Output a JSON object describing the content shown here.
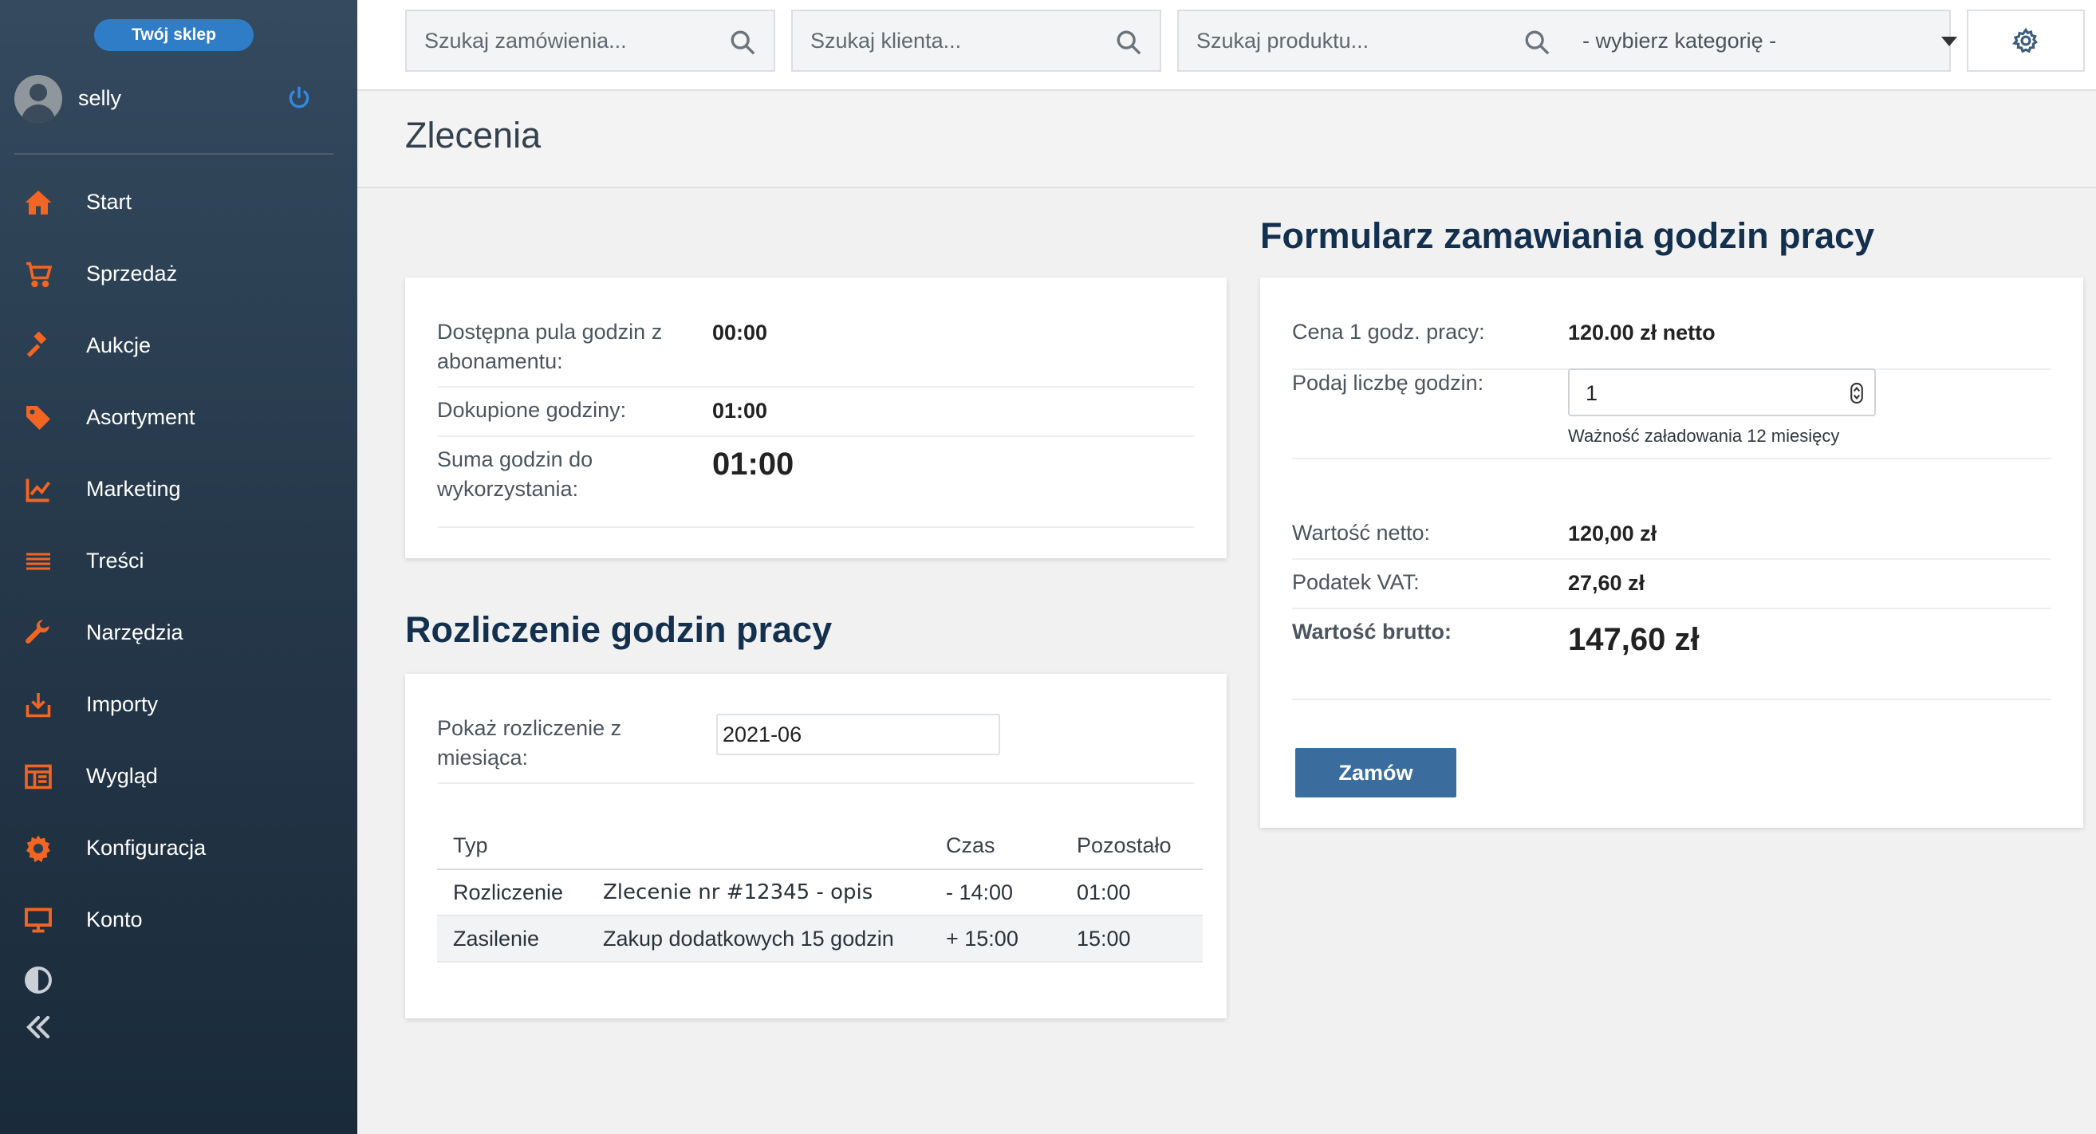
{
  "sidebar": {
    "shop_button": "Twój sklep",
    "user_name": "selly",
    "items": [
      {
        "label": "Start",
        "icon": "home-icon"
      },
      {
        "label": "Sprzedaż",
        "icon": "cart-icon"
      },
      {
        "label": "Aukcje",
        "icon": "gavel-icon"
      },
      {
        "label": "Asortyment",
        "icon": "tag-icon"
      },
      {
        "label": "Marketing",
        "icon": "chart-line-icon"
      },
      {
        "label": "Treści",
        "icon": "lines-icon"
      },
      {
        "label": "Narzędzia",
        "icon": "wrench-icon"
      },
      {
        "label": "Importy",
        "icon": "import-icon"
      },
      {
        "label": "Wygląd",
        "icon": "layout-icon"
      },
      {
        "label": "Konfiguracja",
        "icon": "gear-icon"
      },
      {
        "label": "Konto",
        "icon": "monitor-icon"
      }
    ]
  },
  "topbar": {
    "search_orders_placeholder": "Szukaj zamówienia...",
    "search_clients_placeholder": "Szukaj klienta...",
    "search_products_placeholder": "Szukaj produktu...",
    "category_select": "- wybierz kategorię -"
  },
  "page": {
    "title": "Zlecenia"
  },
  "hours_summary": {
    "available_label": "Dostępna pula godzin z abonamentu:",
    "available_value": "00:00",
    "purchased_label": "Dokupione godziny:",
    "purchased_value": "01:00",
    "total_label": "Suma godzin do wykorzystania:",
    "total_value": "01:00"
  },
  "settlement": {
    "title": "Rozliczenie godzin pracy",
    "month_label": "Pokaż rozliczenie z miesiąca:",
    "month_value": "2021-06",
    "columns": [
      "Typ",
      "",
      "Czas",
      "Pozostało"
    ],
    "rows": [
      {
        "type": "Rozliczenie",
        "desc": "Zlecenie nr #12345 - opis",
        "time": "- 14:00",
        "left": "01:00"
      },
      {
        "type": "Zasilenie",
        "desc": "Zakup dodatkowych 15 godzin",
        "time": "+ 15:00",
        "left": "15:00"
      }
    ]
  },
  "order_form": {
    "title": "Formularz zamawiania godzin pracy",
    "price_label": "Cena 1 godz. pracy:",
    "price_value": "120.00 zł netto",
    "hours_label": "Podaj liczbę godzin:",
    "hours_value": "1",
    "validity_note": "Ważność załadowania 12 miesięcy",
    "net_label": "Wartość netto:",
    "net_value": "120,00 zł",
    "vat_label": "Podatek VAT:",
    "vat_value": "27,60 zł",
    "gross_label": "Wartość brutto:",
    "gross_value": "147,60 zł",
    "order_button": "Zamów"
  },
  "colors": {
    "accent_orange": "#f26522",
    "brand_blue": "#2f7dc7",
    "button_blue": "#3a6d9e",
    "heading_navy": "#13304f"
  }
}
